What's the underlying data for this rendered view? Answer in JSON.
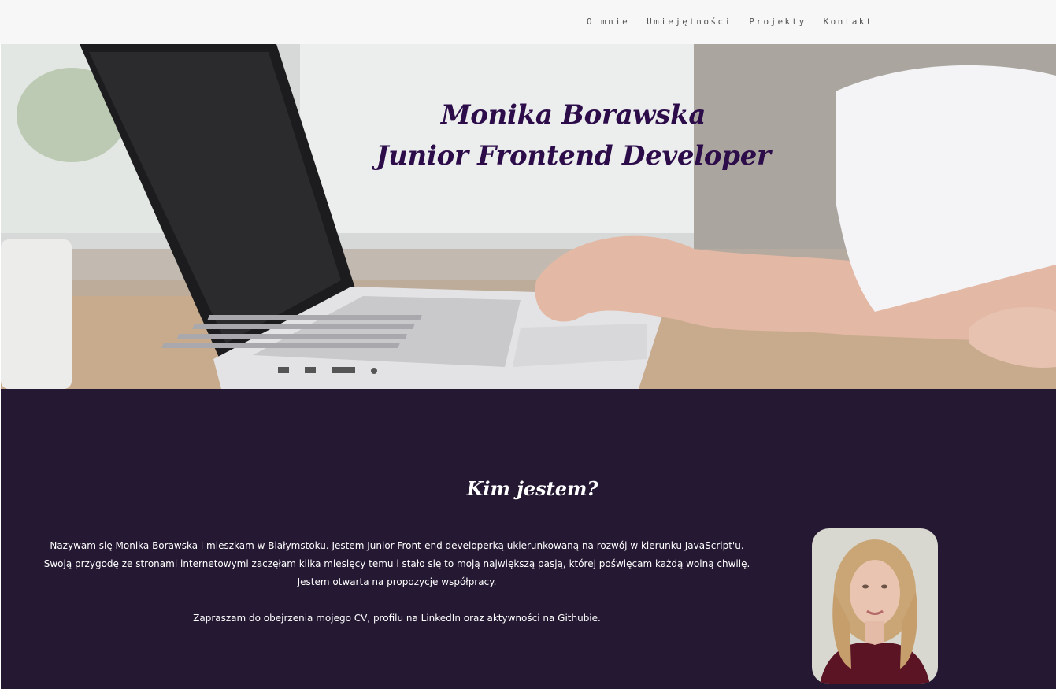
{
  "nav": {
    "items": [
      "O mnie",
      "Umiejętności",
      "Projekty",
      "Kontakt"
    ]
  },
  "hero": {
    "name": "Monika Borawska",
    "role": "Junior Frontend Developer"
  },
  "about": {
    "title": "Kim jestem?",
    "paragraph1": "Nazywam się Monika Borawska i mieszkam w Białymstoku. Jestem Junior Front-end developerką ukierunkowaną na rozwój w kierunku JavaScript'u. Swoją przygodę ze stronami internetowymi zaczęłam kilka miesięcy temu i stało się to moją największą pasją, której poświęcam każdą wolną chwilę. Jestem otwarta na propozycje współpracy.",
    "paragraph2": "Zapraszam do obejrzenia mojego CV, profilu na LinkedIn oraz aktywności na Githubie."
  },
  "colors": {
    "nav_bg": "#f7f7f7",
    "hero_title": "#2d0c4a",
    "about_bg": "#241832"
  }
}
